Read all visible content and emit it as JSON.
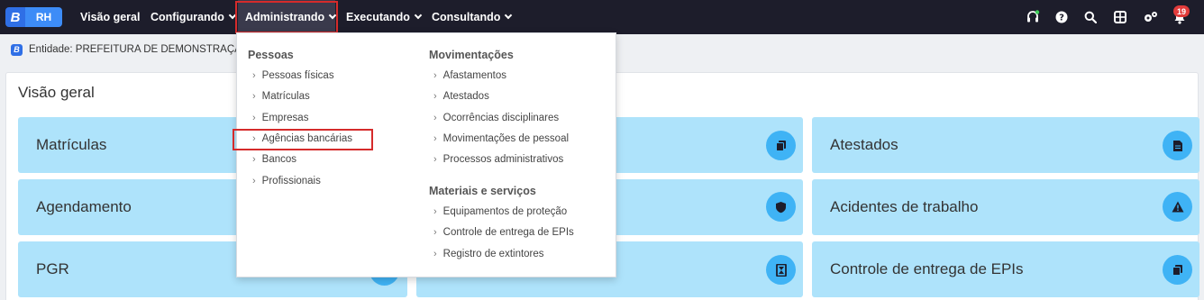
{
  "brand": {
    "letter": "B",
    "product": "RH"
  },
  "nav": [
    {
      "label": "Visão geral"
    },
    {
      "label": "Configurando"
    },
    {
      "label": "Administrando"
    },
    {
      "label": "Executando"
    },
    {
      "label": "Consultando"
    }
  ],
  "toolbar": {
    "icons": [
      "headset-icon",
      "help-icon",
      "search-icon",
      "apps-grid-icon",
      "settings-icon",
      "bell-icon"
    ],
    "notification_count": "19"
  },
  "breadcrumb": {
    "entity": "Entidade: PREFEITURA DE DEMONSTRAÇÃO"
  },
  "panel": {
    "title": "Visão geral"
  },
  "cards": [
    {
      "label": "Matrículas",
      "icon": "copy-icon"
    },
    {
      "label": "Agendamento",
      "icon": ""
    },
    {
      "label": "PGR",
      "icon": ""
    },
    {
      "label": "",
      "icon": "copy-icon"
    },
    {
      "label": "",
      "icon": "shield-icon"
    },
    {
      "label": "",
      "icon": "hourglass-icon"
    },
    {
      "label": "Atestados",
      "icon": "document-icon"
    },
    {
      "label": "Acidentes de trabalho",
      "icon": "warning-icon"
    },
    {
      "label": "Controle de entrega de EPIs",
      "icon": "copy-icon"
    }
  ],
  "menu": {
    "pessoas": {
      "heading": "Pessoas",
      "items": [
        "Pessoas físicas",
        "Matrículas",
        "Empresas",
        "Agências bancárias",
        "Bancos",
        "Profissionais"
      ]
    },
    "movimentacoes": {
      "heading": "Movimentações",
      "items": [
        "Afastamentos",
        "Atestados",
        "Ocorrências disciplinares",
        "Movimentações de pessoal",
        "Processos administrativos"
      ]
    },
    "materiais": {
      "heading": "Materiais e serviços",
      "items": [
        "Equipamentos de proteção",
        "Controle de entrega de EPIs",
        "Registro de extintores"
      ]
    }
  },
  "colors": {
    "topbar": "#1d1d2b",
    "card": "#aee3fb",
    "card_icon": "#3fb3f5",
    "highlight": "#d52b2b",
    "badge": "#e23b3b"
  }
}
